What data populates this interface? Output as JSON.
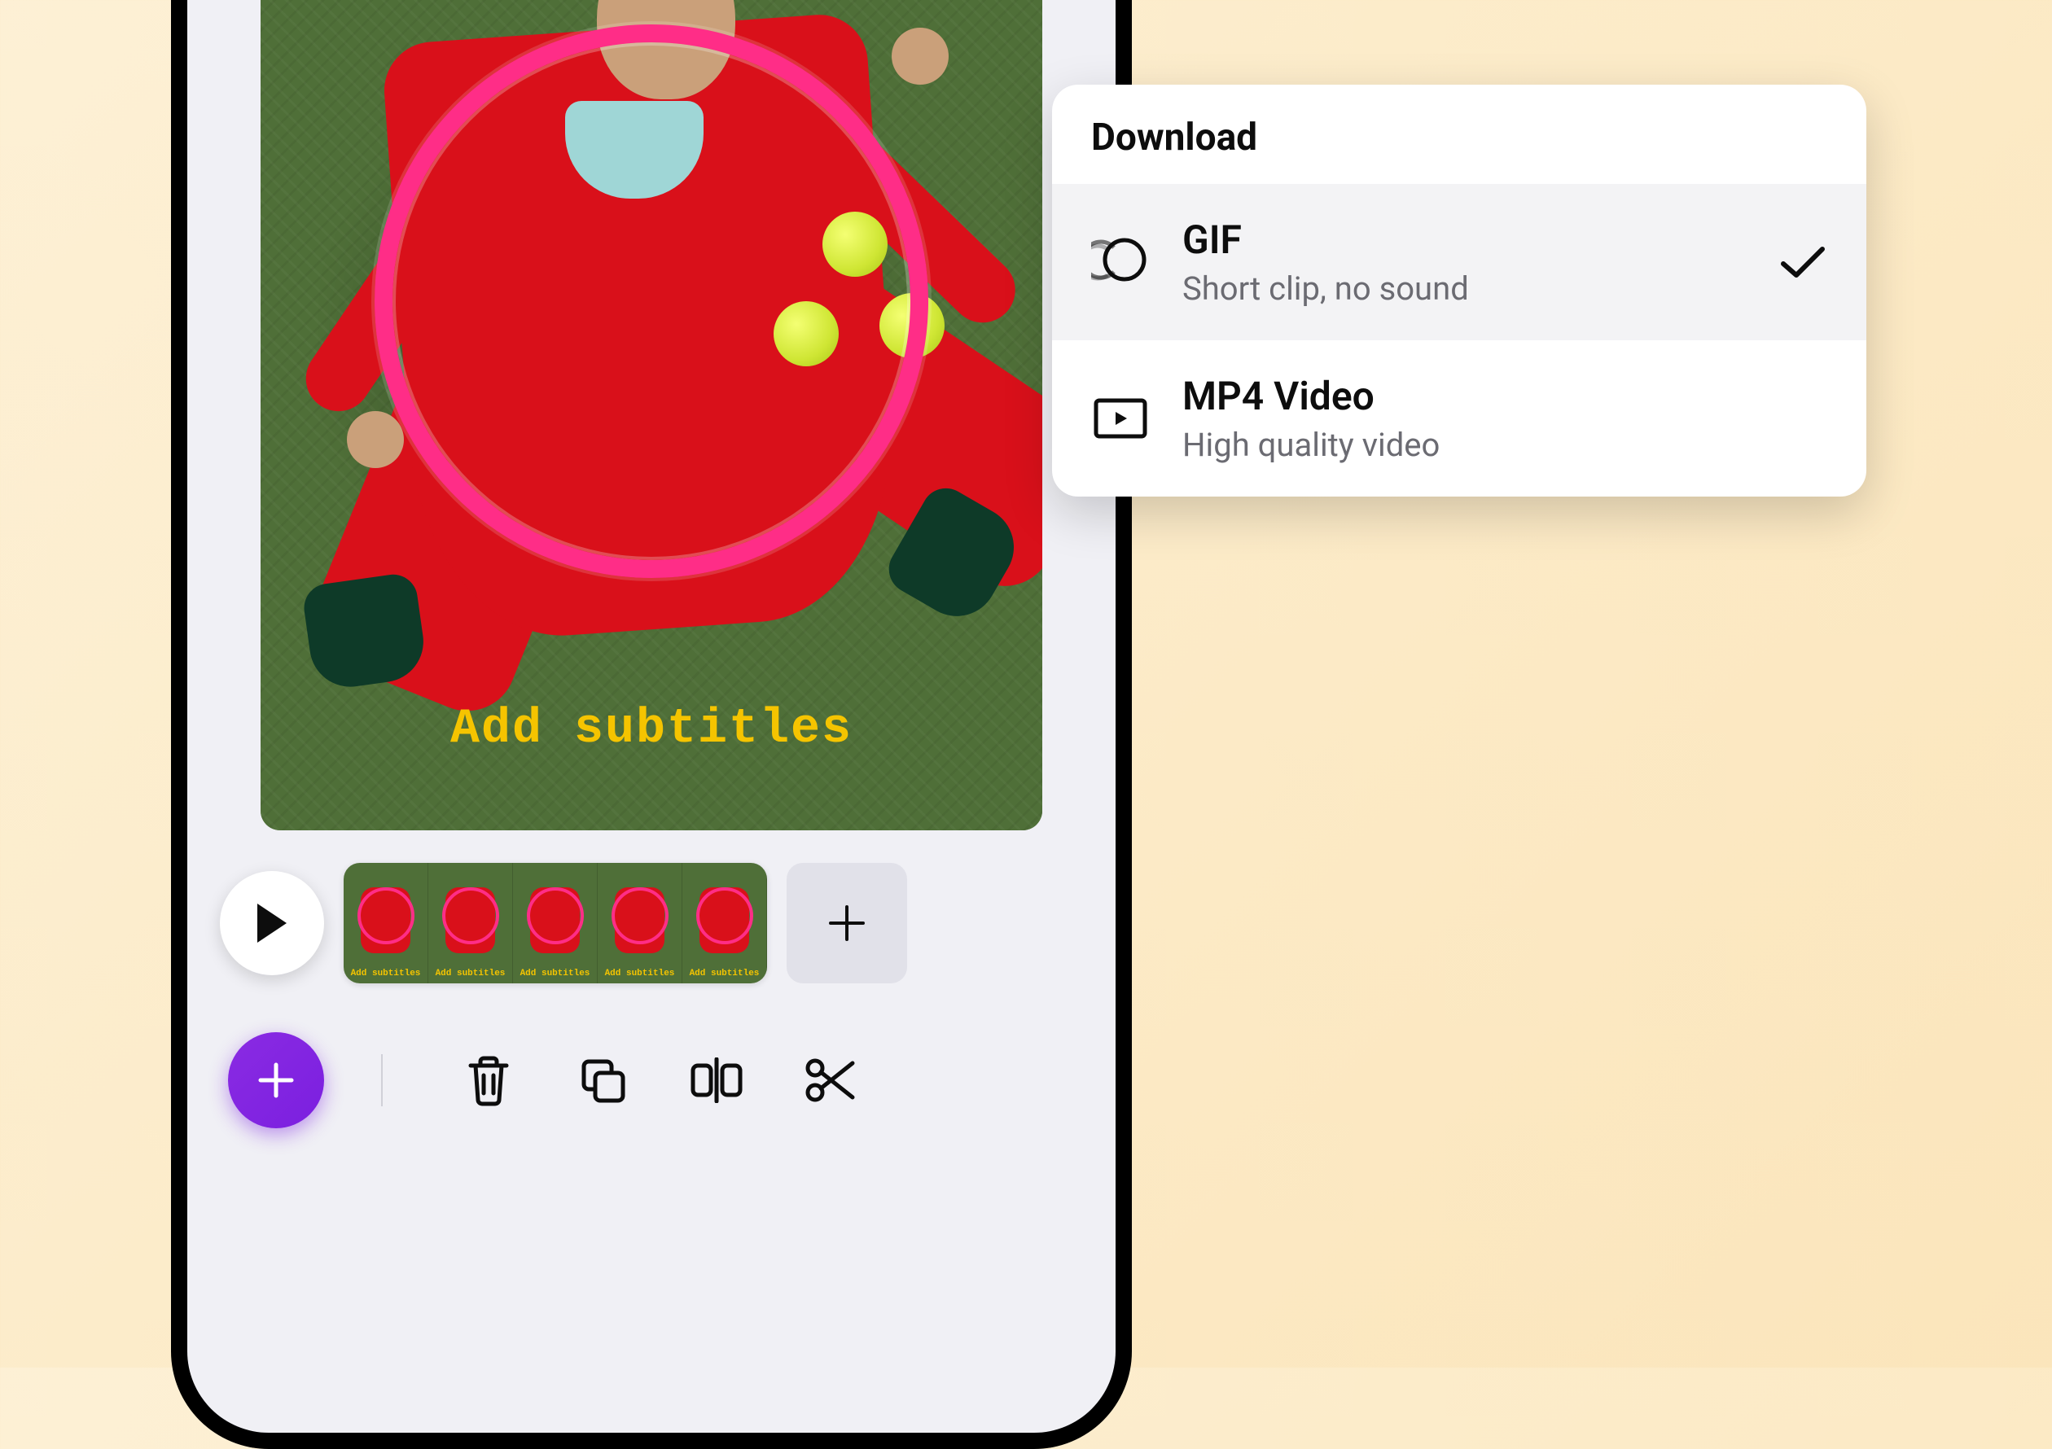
{
  "canvas": {
    "subtitle_text": "Add subtitles"
  },
  "timeline": {
    "frame_label": "Add subtitles",
    "frame_count": 5
  },
  "download_panel": {
    "header": "Download",
    "options": [
      {
        "id": "gif",
        "title": "GIF",
        "desc": "Short clip, no sound",
        "selected": true
      },
      {
        "id": "mp4",
        "title": "MP4 Video",
        "desc": "High quality video",
        "selected": false
      }
    ]
  },
  "icons": {
    "play": "play-icon",
    "add_clip": "plus-icon",
    "fab": "plus-icon",
    "delete": "trash-icon",
    "duplicate": "duplicate-icon",
    "split": "split-icon",
    "cut": "scissors-icon",
    "gif": "gif-icon",
    "mp4": "video-icon",
    "check": "check-icon"
  },
  "colors": {
    "accent": "#7B1FE0",
    "hoop": "#FF2D87",
    "subtitle": "#F5C400",
    "jacket": "#D9101A"
  }
}
